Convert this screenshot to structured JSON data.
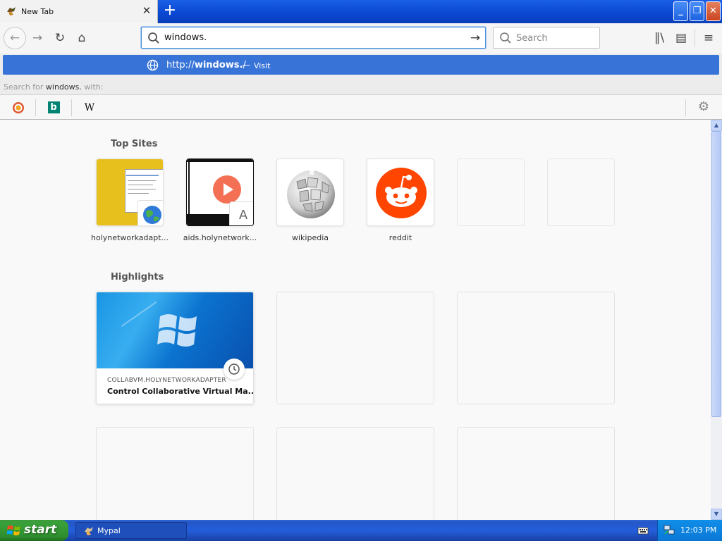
{
  "tab": {
    "title": "New Tab",
    "close_glyph": "✕",
    "new_tab_glyph": "+"
  },
  "window_buttons": {
    "minimize": "_",
    "maximize": "❐",
    "close": "✕"
  },
  "nav": {
    "back_glyph": "←",
    "forward_glyph": "→",
    "reload_glyph": "↻",
    "home_glyph": "⌂",
    "url_value": "windows.",
    "go_glyph": "→",
    "search_placeholder": "Search",
    "library_glyph": "∥\\",
    "sidebar_glyph": "▤",
    "menu_glyph": "≡"
  },
  "urlbar_popup": {
    "visit_url_prefix": "http://",
    "visit_url_host": "windows.",
    "visit_url_suffix": "/",
    "visit_dash": "—",
    "visit_action": "Visit",
    "search_for_prefix": "Search for ",
    "search_for_term": "windows.",
    "search_for_suffix": " with:",
    "engines": [
      {
        "name": "duckduckgo"
      },
      {
        "name": "bing",
        "glyph": "b"
      },
      {
        "name": "wikipedia",
        "glyph": "W"
      }
    ],
    "settings_glyph": "⚙"
  },
  "top_sites": {
    "title": "Top Sites",
    "tiles": [
      {
        "label": "holynetworkadapt...",
        "badge_glyph": ""
      },
      {
        "label": "aids.holynetwork...",
        "badge_glyph": "A"
      },
      {
        "label": "wikipedia"
      },
      {
        "label": "reddit"
      }
    ]
  },
  "highlights": {
    "title": "Highlights",
    "cards": [
      {
        "host": "COLLABVM.HOLYNETWORKADAPTER",
        "title": "Control Collaborative Virtual Ma..."
      }
    ]
  },
  "taskbar": {
    "start_label": "start",
    "tasks": [
      {
        "label": "Mypal"
      }
    ],
    "clock": "12:03 PM"
  },
  "colors": {
    "url_highlight": "#3874d8",
    "reddit_orange": "#ff4500",
    "xp_taskbar": "#245edb",
    "xp_start_green": "#3c9c3c"
  }
}
